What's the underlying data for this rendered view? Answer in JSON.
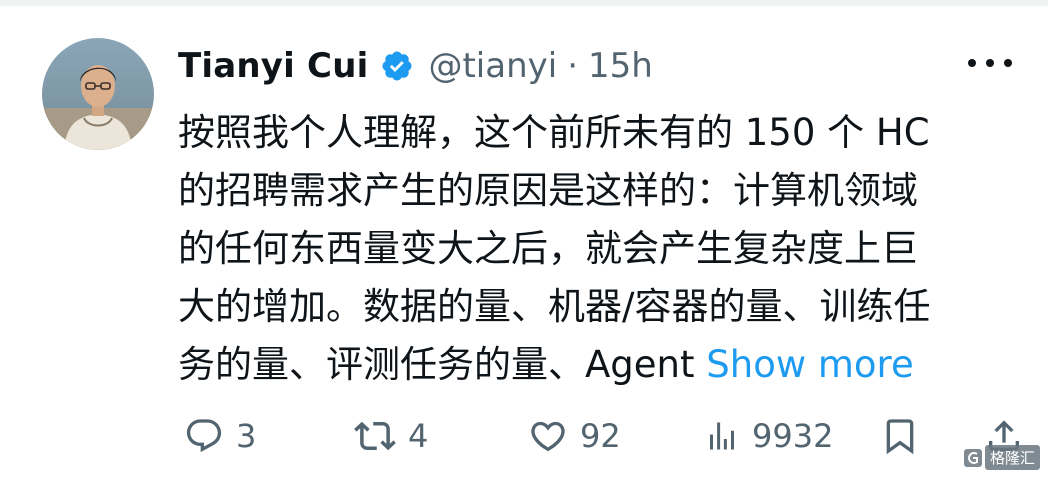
{
  "tweet": {
    "author_name": "Tianyi Cui",
    "handle": "@tianyi",
    "separator": "·",
    "time": "15h",
    "lines": [
      "按照我个人理解，这个前所未有的 150 个 HC",
      "的招聘需求产生的原因是这样的：计算机领域",
      "的任何东西量变大之后，就会产生复杂度上巨",
      "大的增加。数据的量、机器/容器的量、训练任",
      "务的量、评测任务的量、Agent "
    ],
    "show_more": "Show more"
  },
  "actions": {
    "replies": "3",
    "retweets": "4",
    "likes": "92",
    "views": "9932"
  },
  "icons": {
    "verified": "verified-badge-icon",
    "more": "more-icon",
    "reply": "reply-icon",
    "retweet": "retweet-icon",
    "like": "heart-icon",
    "views": "views-icon",
    "bookmark": "bookmark-icon",
    "share": "share-icon"
  },
  "colors": {
    "text": "#0f1419",
    "secondary": "#536471",
    "link": "#1d9bf0",
    "verified": "#1d9bf0"
  },
  "watermark": {
    "text": "格隆汇"
  }
}
